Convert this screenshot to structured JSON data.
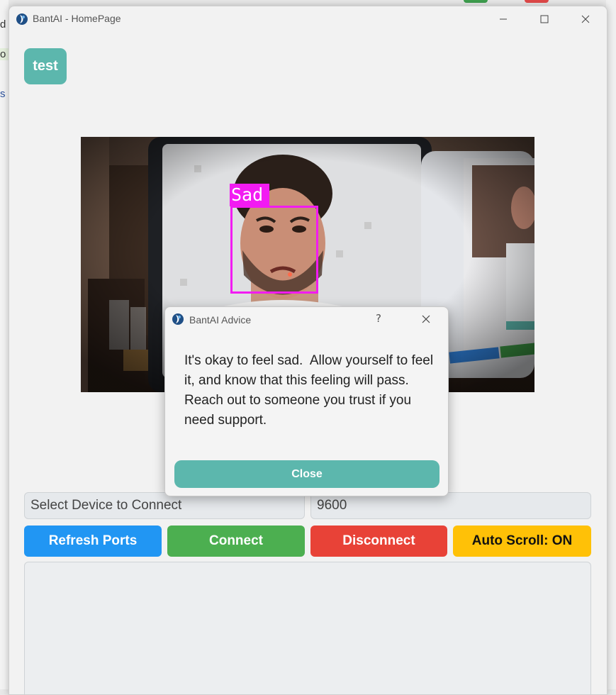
{
  "window": {
    "title": "BantAI - HomePage"
  },
  "main": {
    "test_button": "test",
    "detection_label": "Sad",
    "device_select": "Select Device to Connect",
    "baud_rate": "9600"
  },
  "buttons": {
    "refresh": "Refresh Ports",
    "connect": "Connect",
    "disconnect": "Disconnect",
    "autoscroll": "Auto Scroll: ON"
  },
  "dialog": {
    "title": "BantAI Advice",
    "help": "?",
    "message": "It's okay to feel sad.  Allow yourself to feel it, and know that this feeling will pass.  Reach out to someone you trust if you need support.",
    "close_label": "Close"
  },
  "colors": {
    "accent_teal": "#5cb7ad",
    "refresh_blue": "#2196f3",
    "connect_green": "#4caf50",
    "disconnect_red": "#e84237",
    "autoscroll_yellow": "#ffc107",
    "detection_magenta": "#f21bf2"
  },
  "icons": {
    "app_icon": "bantai-logo-icon",
    "minimize": "minimize-icon",
    "maximize": "maximize-icon",
    "close": "close-icon"
  }
}
